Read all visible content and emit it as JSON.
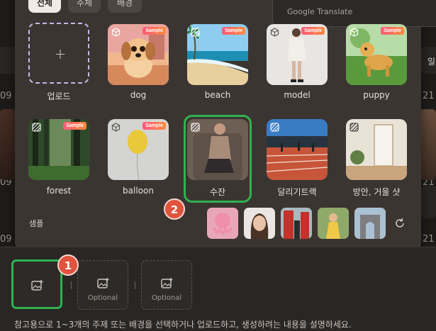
{
  "filter_tabs": [
    {
      "label": "전체",
      "active": true
    },
    {
      "label": "주체",
      "active": false
    },
    {
      "label": "배경",
      "active": false
    }
  ],
  "google_translate": "Google Translate",
  "cards_row1": [
    {
      "label": "업로드",
      "kind": "upload"
    },
    {
      "label": "dog",
      "badge": "Sample"
    },
    {
      "label": "beach",
      "badge": "Sample"
    },
    {
      "label": "model",
      "badge": "Sample"
    },
    {
      "label": "puppy",
      "badge": "Sample"
    }
  ],
  "cards_row2": [
    {
      "label": "forest",
      "badge": "Sample"
    },
    {
      "label": "balloon",
      "badge": "Sample"
    },
    {
      "label": "수잔"
    },
    {
      "label": "달리기트랙"
    },
    {
      "label": "방안, 거울 샷"
    }
  ],
  "samples_label": "샘플",
  "callouts": [
    "1",
    "2"
  ],
  "bottom_slots": [
    {
      "label": ""
    },
    {
      "label": "Optional"
    },
    {
      "label": "Optional"
    }
  ],
  "hint": "참고용으로 1~3개의 주제 또는 배경을 선택하거나 업로드하고, 생성하려는 내용을 설명하세요.",
  "bg_numbers": [
    "09",
    "09",
    "09",
    "21",
    "21",
    "21"
  ],
  "bg_tab_right": "일",
  "colors": {
    "selection": "#2fb24f",
    "callout": "#e0533d",
    "badge": "#ff5a7a",
    "upload_border": "#c6b7e6"
  }
}
